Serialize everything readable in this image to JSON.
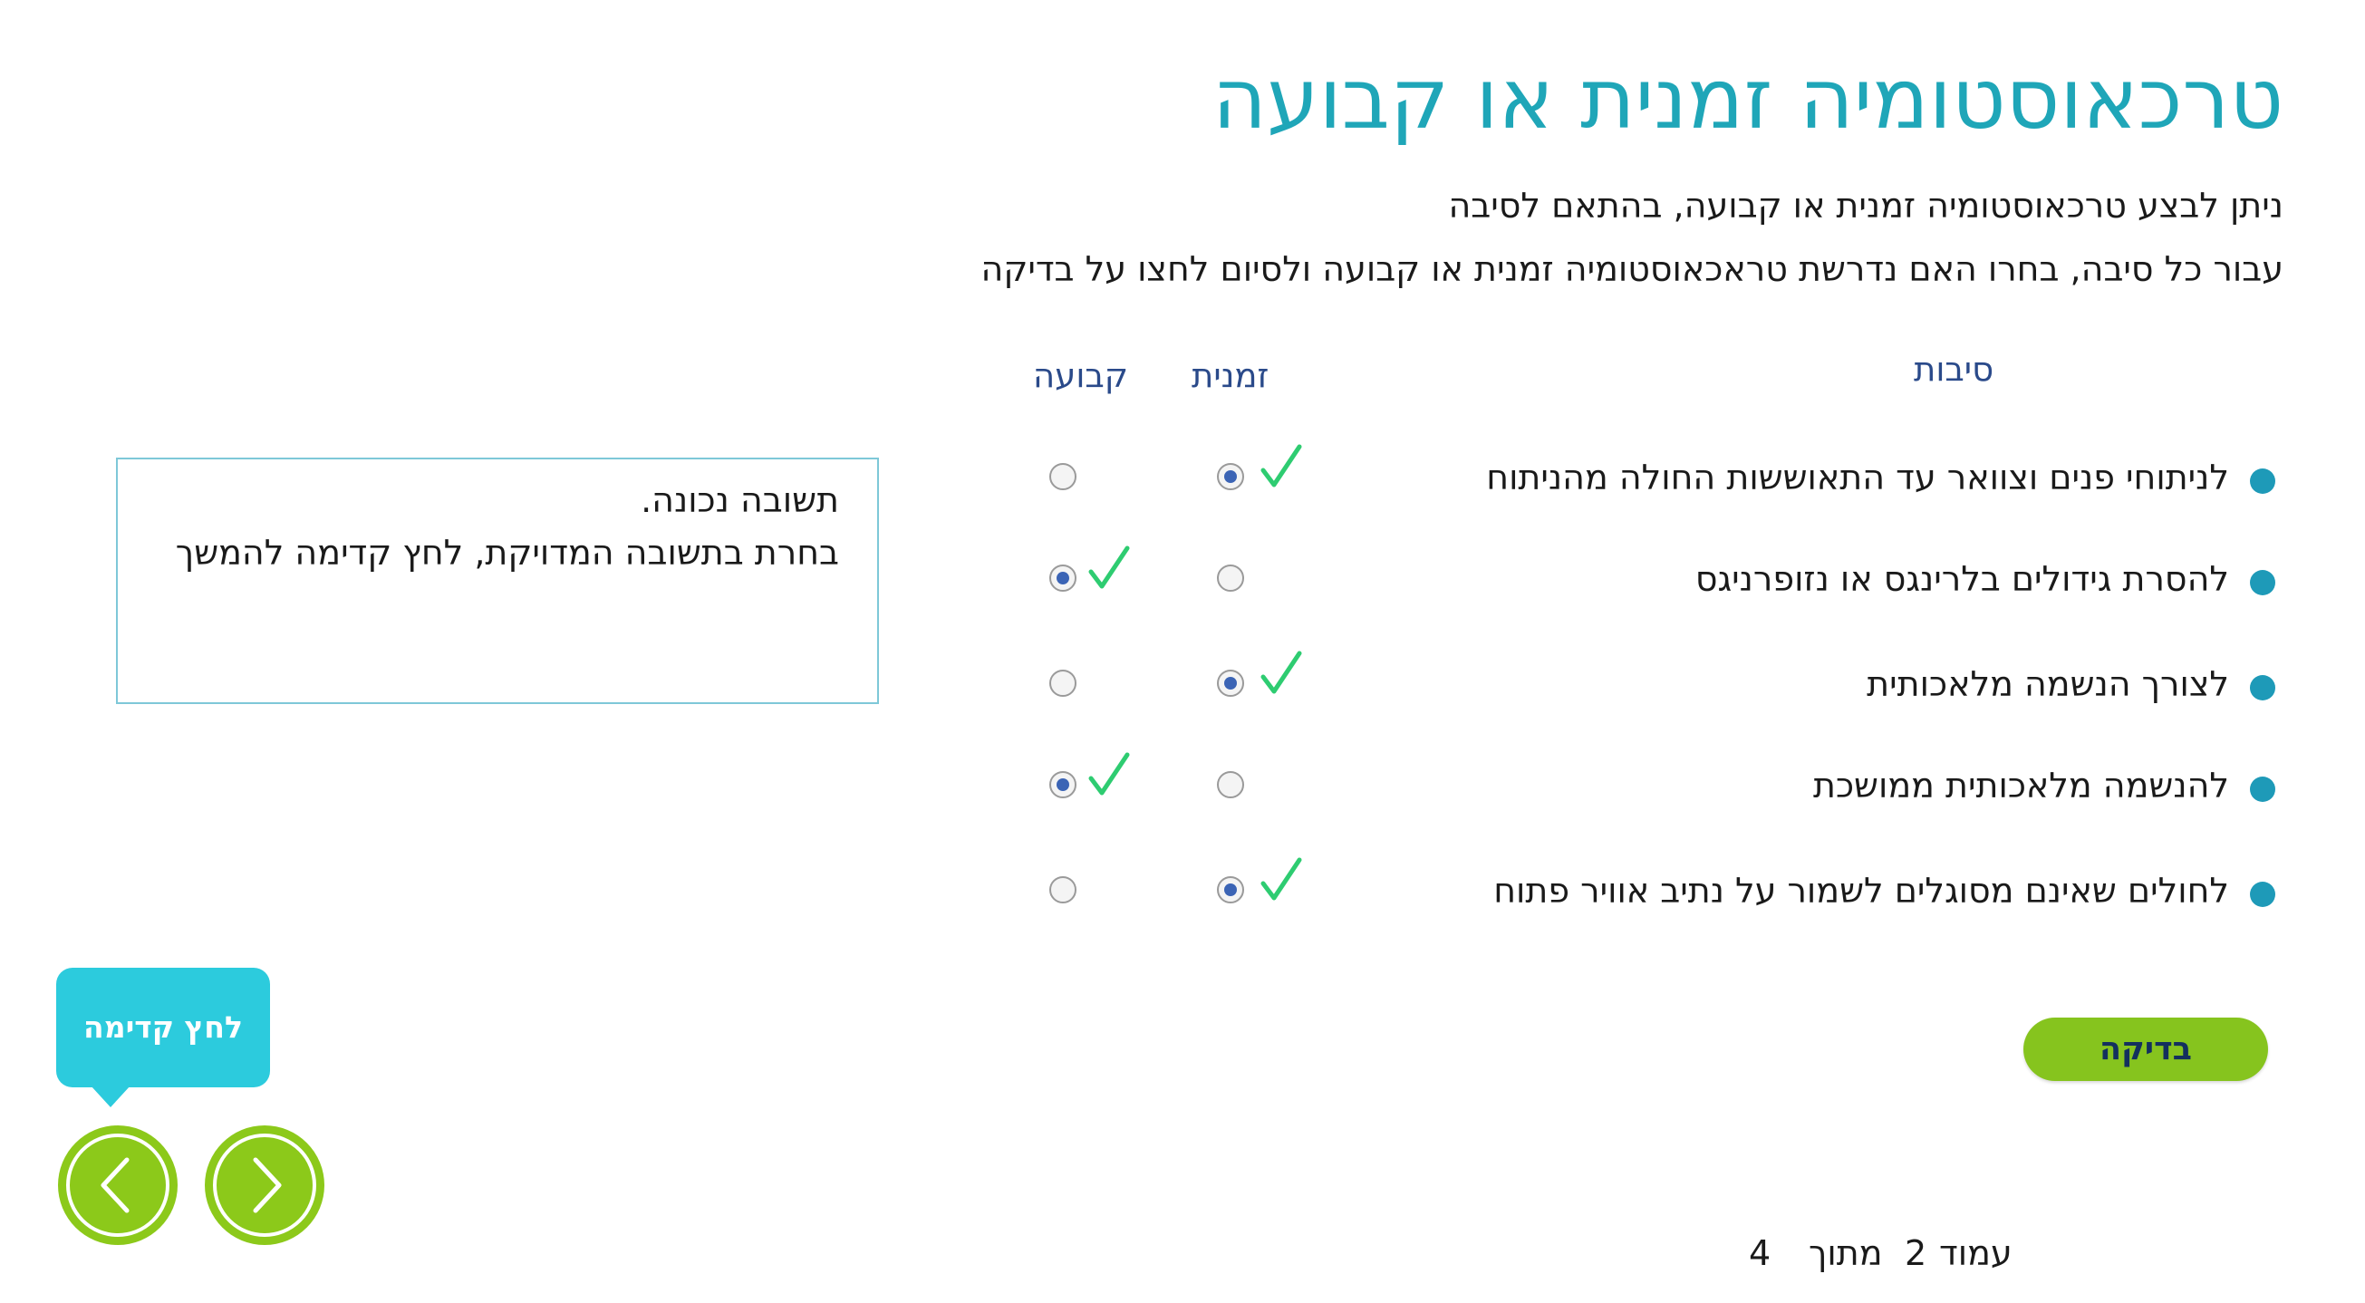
{
  "title": "טרכאוסטומיה זמנית או קבועה",
  "intro": {
    "line1": "ניתן לבצע טרכאוסטומיה זמנית או קבועה, בהתאם לסיבה",
    "line2": "עבור כל סיבה, בחרו האם נדרשת טראכאוסטומיה זמנית או קבועה ולסיום לחצו על בדיקה"
  },
  "columns": {
    "reasons": "סיבות",
    "temporary": "זמנית",
    "permanent": "קבועה"
  },
  "rows": [
    {
      "reason": "לניתוחי פנים וצוואר עד התאוששות החולה מהניתוח",
      "selected": "temporary"
    },
    {
      "reason": "להסרת גידולים בלרינגס או נזופרניגס",
      "selected": "permanent"
    },
    {
      "reason": "לצורך הנשמה מלאכותית",
      "selected": "temporary"
    },
    {
      "reason": "להנשמה מלאכותית ממושכת",
      "selected": "permanent"
    },
    {
      "reason": "לחולים שאינם מסוגלים לשמור על נתיב אוויר פתוח",
      "selected": "temporary"
    }
  ],
  "feedback": {
    "line1": "תשובה נכונה.",
    "line2": "בחרת בתשובה המדויקת, לחץ קדימה להמשך"
  },
  "check_button": "בדיקה",
  "tooltip": "לחץ קדימה",
  "pager": {
    "word_page": "עמוד",
    "current": "2",
    "word_of": "מתוך",
    "total": "4"
  },
  "colors": {
    "title": "#1fa6b8",
    "bullet": "#1e9ab8",
    "check_button": "#86c41e",
    "tooltip": "#2ccbdd",
    "checkmark": "#2ecc71",
    "nav": "#8cc91a"
  }
}
